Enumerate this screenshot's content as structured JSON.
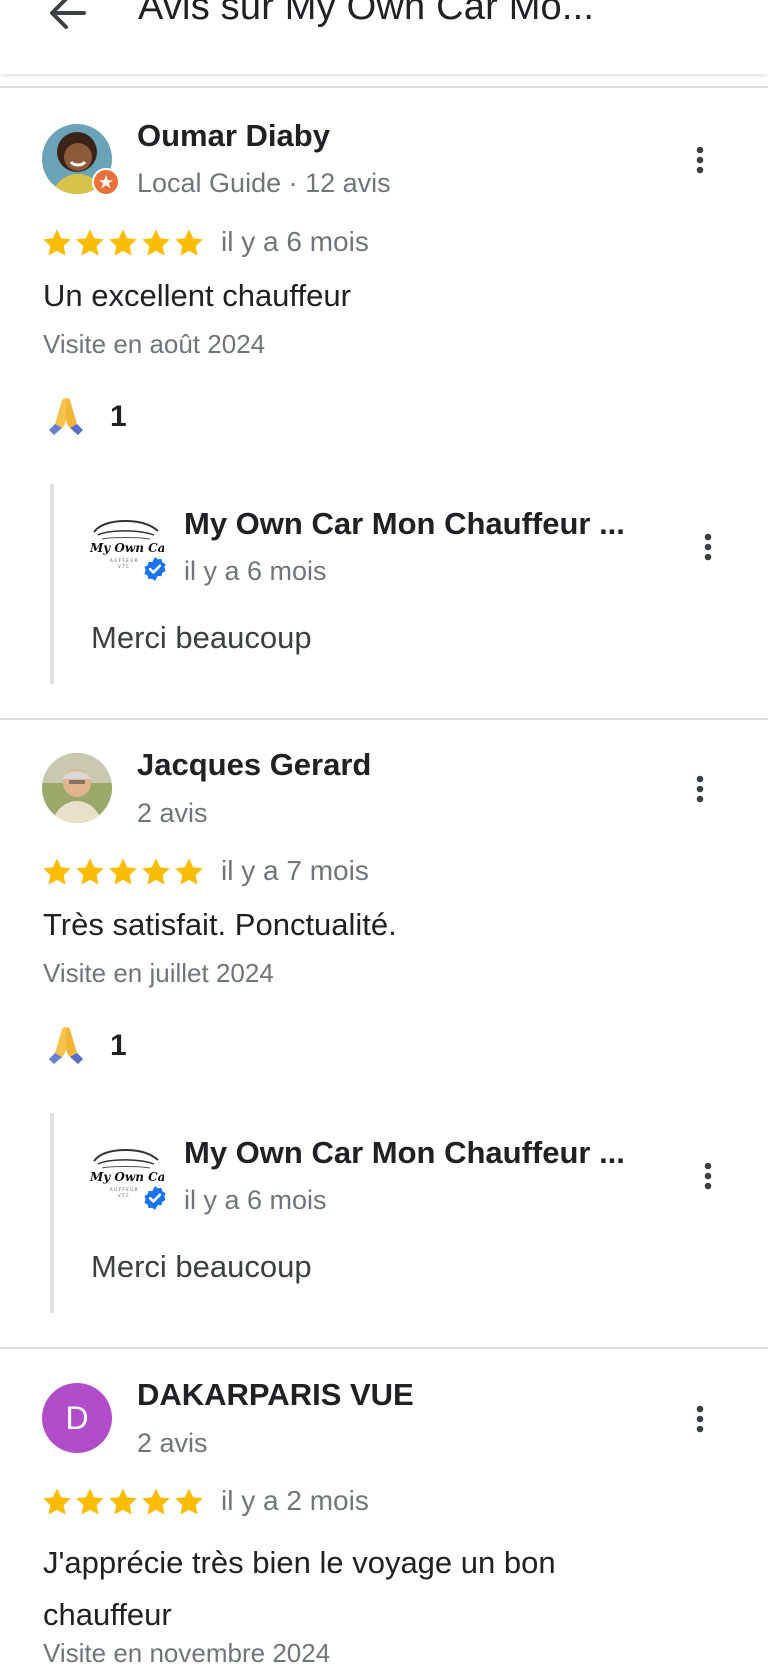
{
  "header": {
    "title": "Avis sur My Own Car Mo...",
    "back_icon": "arrow-left-icon"
  },
  "colors": {
    "star": "#fbbc04",
    "local_guide": "#e8703a",
    "verified": "#1a73e8",
    "letter_avatar": "#b14dc9"
  },
  "reviews": [
    {
      "author": "Oumar Diaby",
      "meta": "Local Guide · 12 avis",
      "rating": 5,
      "date": "il y a 6 mois",
      "text": "Un excellent chauffeur",
      "visit": "Visite en août 2024",
      "reaction_icon": "praying-hands-icon",
      "reaction_count": "1",
      "reply": {
        "owner": "My Own Car Mon Chauffeur ...",
        "logo_text": "My Own Car",
        "date": "il y a 6 mois",
        "text": "Merci beaucoup"
      }
    },
    {
      "author": "Jacques Gerard",
      "meta": "2 avis",
      "rating": 5,
      "date": "il y a 7 mois",
      "text": "Très satisfait. Ponctualité.",
      "visit": "Visite en juillet 2024",
      "reaction_icon": "praying-hands-icon",
      "reaction_count": "1",
      "reply": {
        "owner": "My Own Car Mon Chauffeur ...",
        "logo_text": "My Own Car",
        "date": "il y a 6 mois",
        "text": "Merci beaucoup"
      }
    },
    {
      "author": "DAKARPARIS VUE",
      "avatar_letter": "D",
      "meta": "2 avis",
      "rating": 5,
      "date": "il y a 2 mois",
      "text": "J'apprécie très bien le voyage un bon chauffeur",
      "visit": "Visite en novembre 2024"
    }
  ]
}
